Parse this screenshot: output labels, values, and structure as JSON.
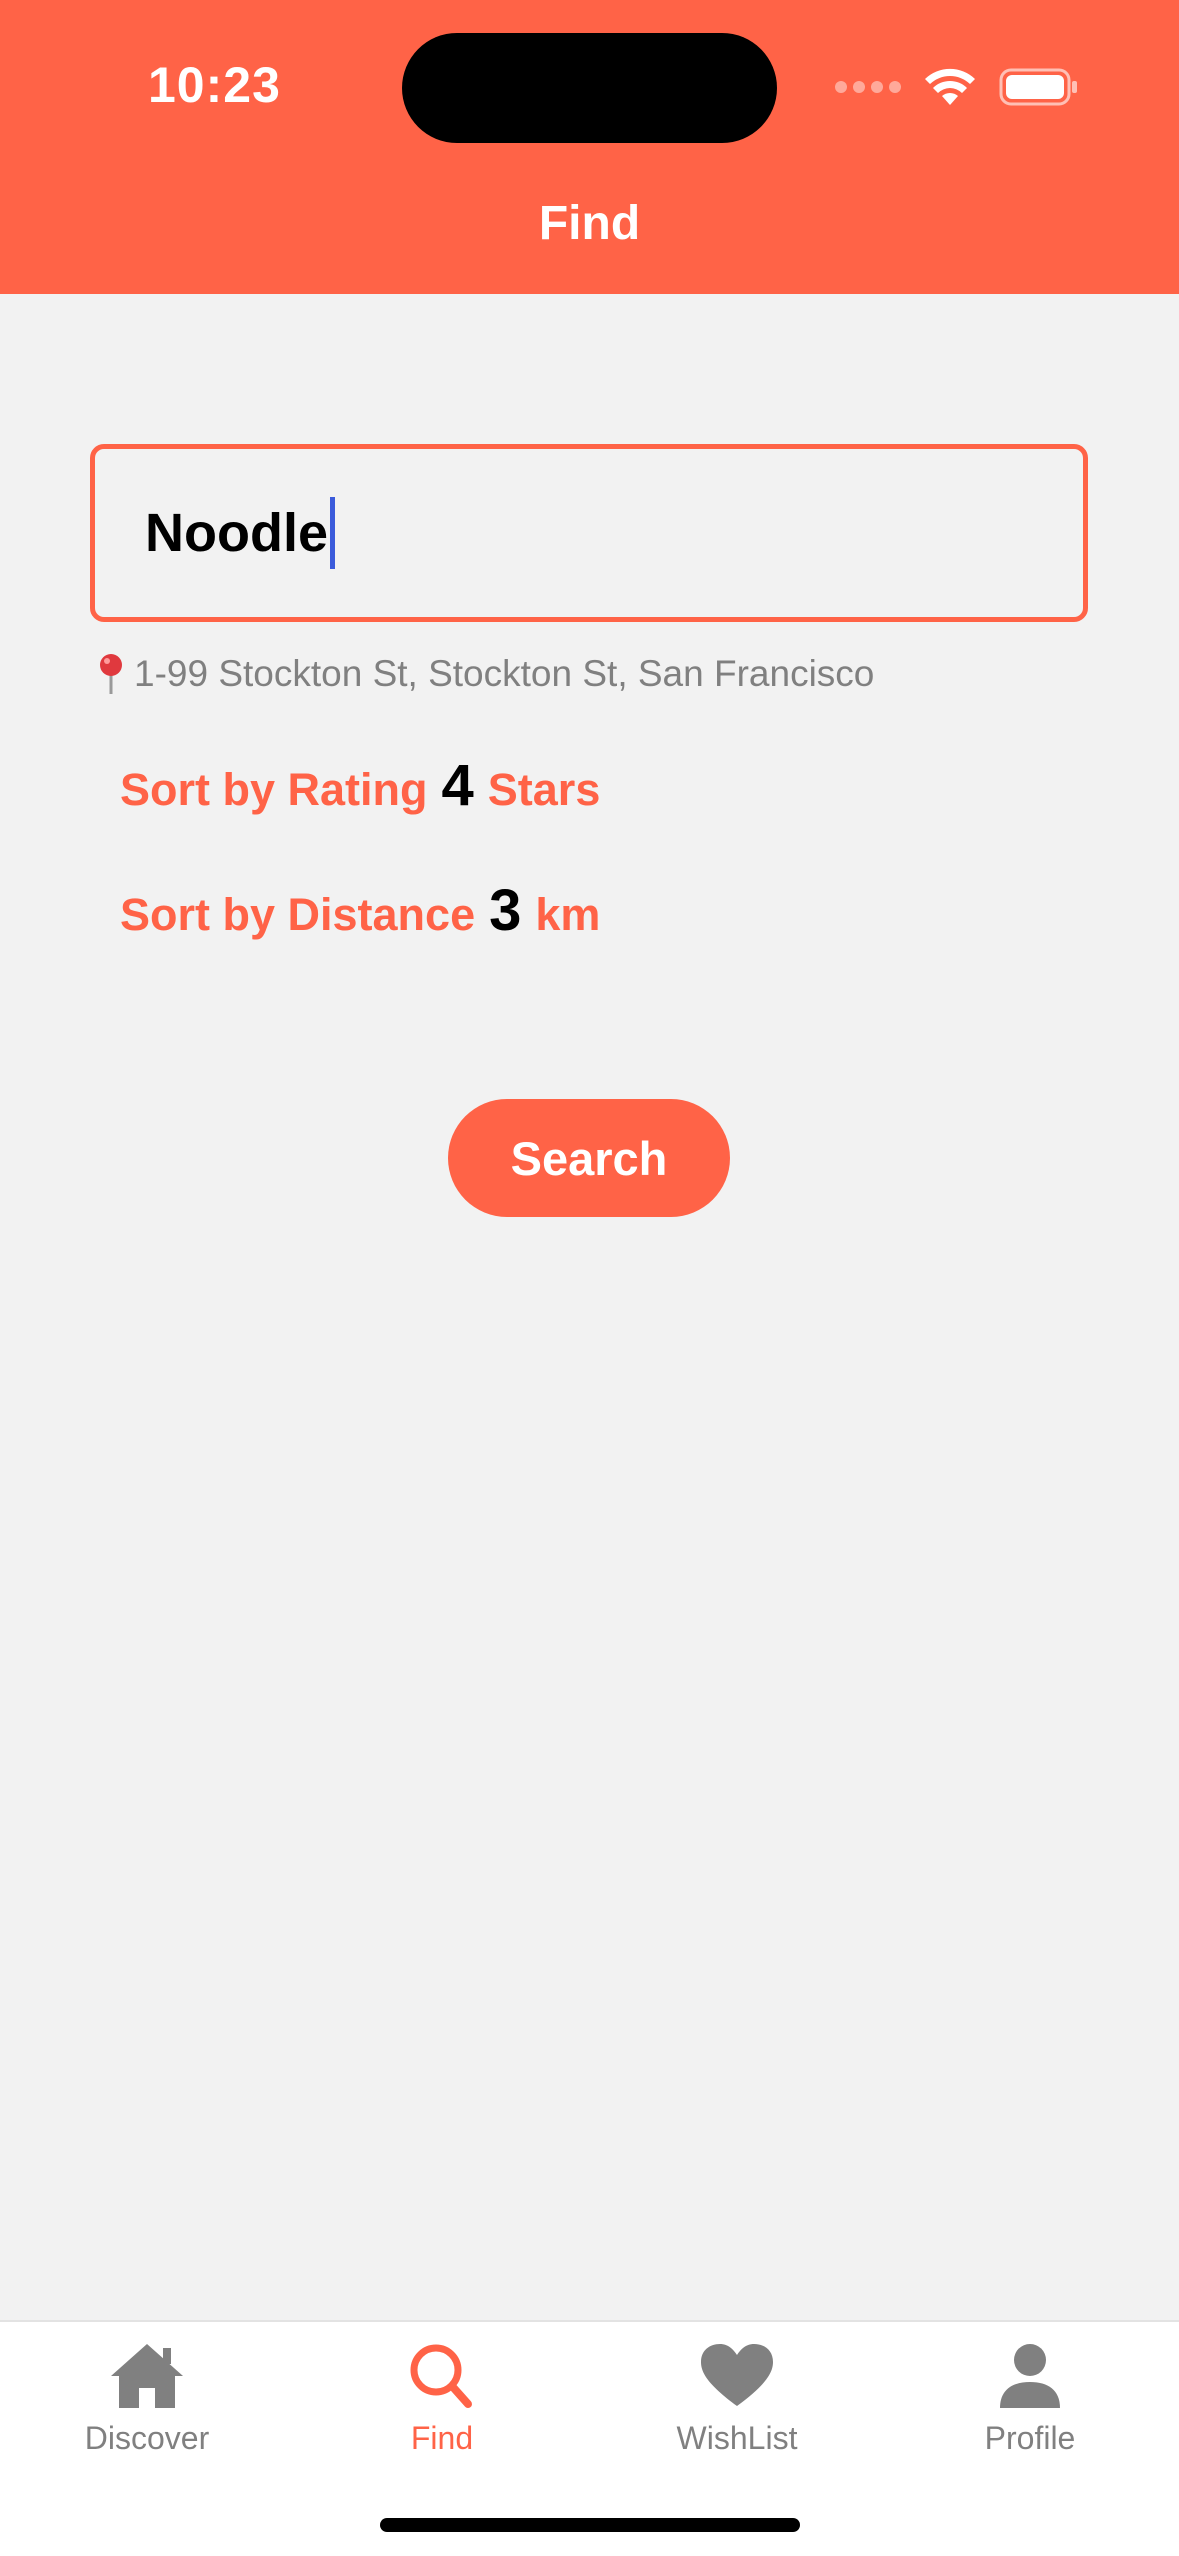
{
  "status_bar": {
    "time": "10:23"
  },
  "header": {
    "title": "Find"
  },
  "search": {
    "value": "Noodle"
  },
  "location": {
    "pin_icon": "pin-icon",
    "address": "1-99 Stockton St, Stockton St, San Francisco"
  },
  "sort_rating": {
    "prefix": "Sort by Rating",
    "value": "4",
    "suffix": "Stars"
  },
  "sort_distance": {
    "prefix": "Sort by Distance",
    "value": "3",
    "suffix": "km"
  },
  "search_button": {
    "label": "Search"
  },
  "tabbar": {
    "items": [
      {
        "label": "Discover",
        "icon": "home-icon",
        "active": false
      },
      {
        "label": "Find",
        "icon": "search-icon",
        "active": true
      },
      {
        "label": "WishList",
        "icon": "heart-icon",
        "active": false
      },
      {
        "label": "Profile",
        "icon": "person-icon",
        "active": false
      }
    ]
  },
  "colors": {
    "accent": "#ff6347",
    "background": "#f2f2f2",
    "inactive": "#808080",
    "caret": "#3b5bdb"
  }
}
